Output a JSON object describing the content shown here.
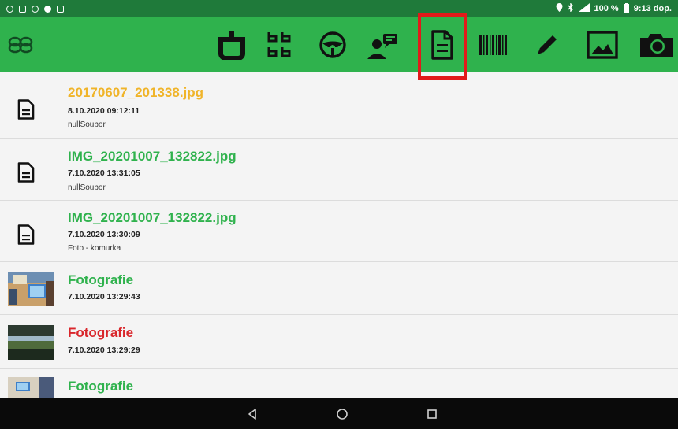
{
  "status_bar": {
    "right_text": "100 %",
    "time": "9:13 dop."
  },
  "toolbar": {
    "icons": [
      "clover-icon",
      "scale-icon",
      "grid-icon",
      "steering-wheel-icon",
      "person-message-icon",
      "document-icon",
      "barcode-icon",
      "pencil-icon",
      "image-icon",
      "camera-icon"
    ],
    "selected": "document-icon",
    "colors": {
      "background": "#2fb24d",
      "highlight": "#e21a1a"
    }
  },
  "list": {
    "items": [
      {
        "title": "20170607_201338.jpg",
        "color": "#f0b429",
        "date": "8.10.2020 09:12:11",
        "sub": "nullSoubor",
        "kind": "document"
      },
      {
        "title": "IMG_20201007_132822.jpg",
        "color": "#2fb24d",
        "date": "7.10.2020 13:31:05",
        "sub": "nullSoubor",
        "kind": "document"
      },
      {
        "title": "IMG_20201007_132822.jpg",
        "color": "#2fb24d",
        "date": "7.10.2020 13:30:09",
        "sub": "Foto - komurka",
        "kind": "document"
      },
      {
        "title": "Fotografie",
        "color": "#2fb24d",
        "date": "7.10.2020 13:29:43",
        "sub": "",
        "kind": "photo"
      },
      {
        "title": "Fotografie",
        "color": "#d9262b",
        "date": "7.10.2020 13:29:29",
        "sub": "",
        "kind": "photo"
      },
      {
        "title": "Fotografie",
        "color": "#2fb24d",
        "date": "",
        "sub": "",
        "kind": "photo"
      }
    ]
  },
  "nav_bar": {
    "buttons": [
      "back-icon",
      "home-icon",
      "recents-icon"
    ]
  }
}
